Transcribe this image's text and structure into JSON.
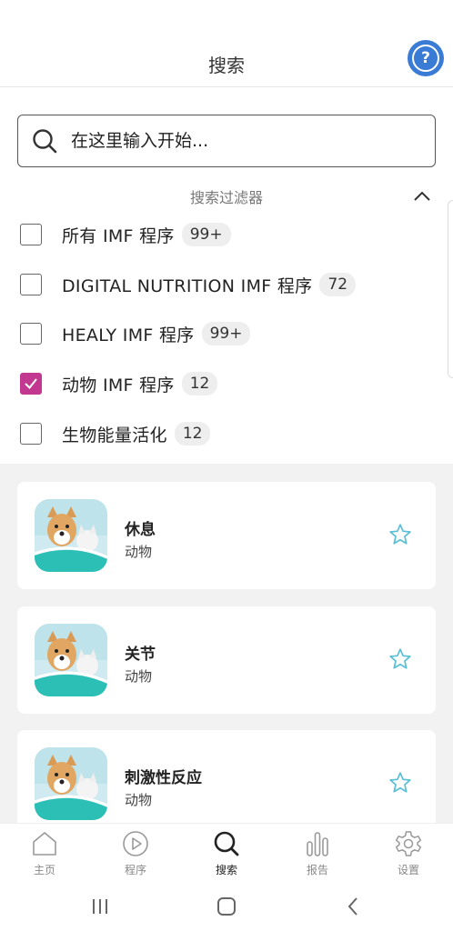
{
  "header": {
    "title": "搜索",
    "help_icon": "help-circle-icon"
  },
  "search": {
    "placeholder": "在这里输入开始..."
  },
  "filters": {
    "title": "搜索过滤器",
    "items": [
      {
        "label": "所有 IMF 程序",
        "count": "99+",
        "checked": false
      },
      {
        "label": "DIGITAL NUTRITION IMF 程序",
        "count": "72",
        "checked": false
      },
      {
        "label": "HEALY IMF 程序",
        "count": "99+",
        "checked": false
      },
      {
        "label": "动物 IMF 程序",
        "count": "12",
        "checked": true
      },
      {
        "label": "生物能量活化",
        "count": "12",
        "checked": false
      }
    ]
  },
  "results": [
    {
      "title": "休息",
      "category": "动物"
    },
    {
      "title": "关节",
      "category": "动物"
    },
    {
      "title": "刺激性反应",
      "category": "动物"
    }
  ],
  "bottom_nav": [
    {
      "label": "主页",
      "icon": "home-icon"
    },
    {
      "label": "程序",
      "icon": "play-icon"
    },
    {
      "label": "搜索",
      "icon": "search-icon",
      "active": true
    },
    {
      "label": "报告",
      "icon": "bar-chart-icon"
    },
    {
      "label": "设置",
      "icon": "gear-icon"
    }
  ],
  "colors": {
    "accent": "#c2378f",
    "star": "#5bbfd6",
    "help": "#3a7bd5",
    "background_list": "#f2f2f2"
  }
}
